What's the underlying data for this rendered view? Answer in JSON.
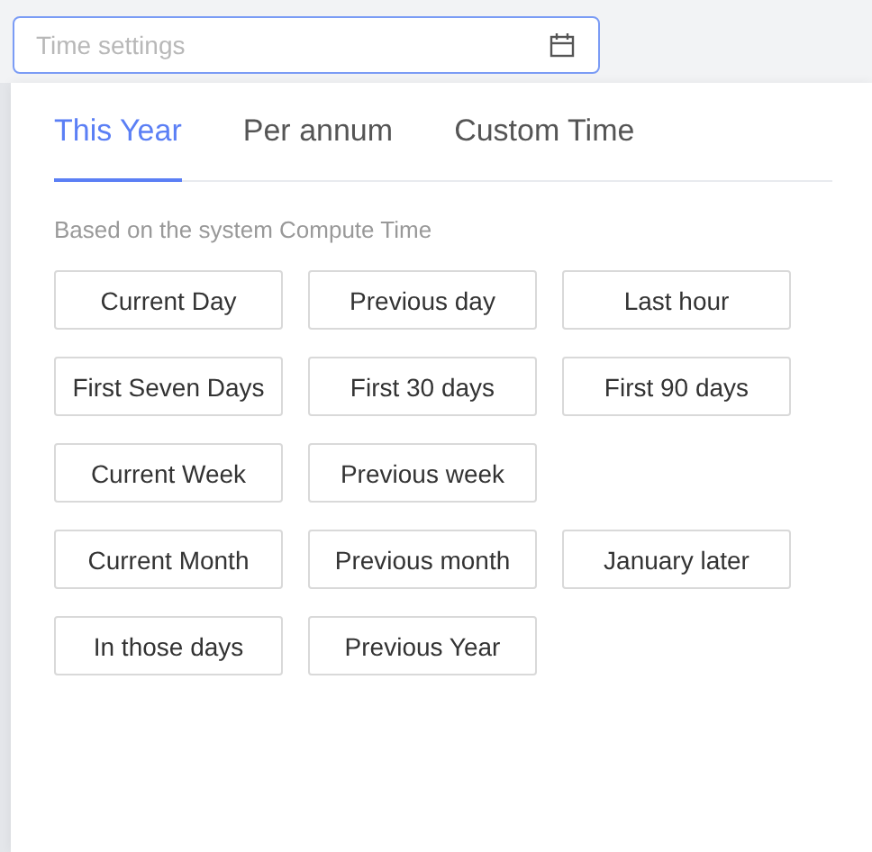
{
  "date_field": {
    "placeholder": "Time settings"
  },
  "tabs": [
    {
      "label": "This Year",
      "selected": true
    },
    {
      "label": "Per annum",
      "selected": false
    },
    {
      "label": "Custom Time",
      "selected": false
    }
  ],
  "hint": "Based on the system Compute Time",
  "preset_rows": [
    [
      "Current Day",
      "Previous day",
      "Last hour"
    ],
    [
      "First Seven Days",
      "First 30 days",
      "First 90 days"
    ],
    [
      "Current Week",
      "Previous week"
    ],
    [
      "Current Month",
      "Previous month",
      "January later"
    ],
    [
      "In those days",
      "Previous Year"
    ]
  ]
}
